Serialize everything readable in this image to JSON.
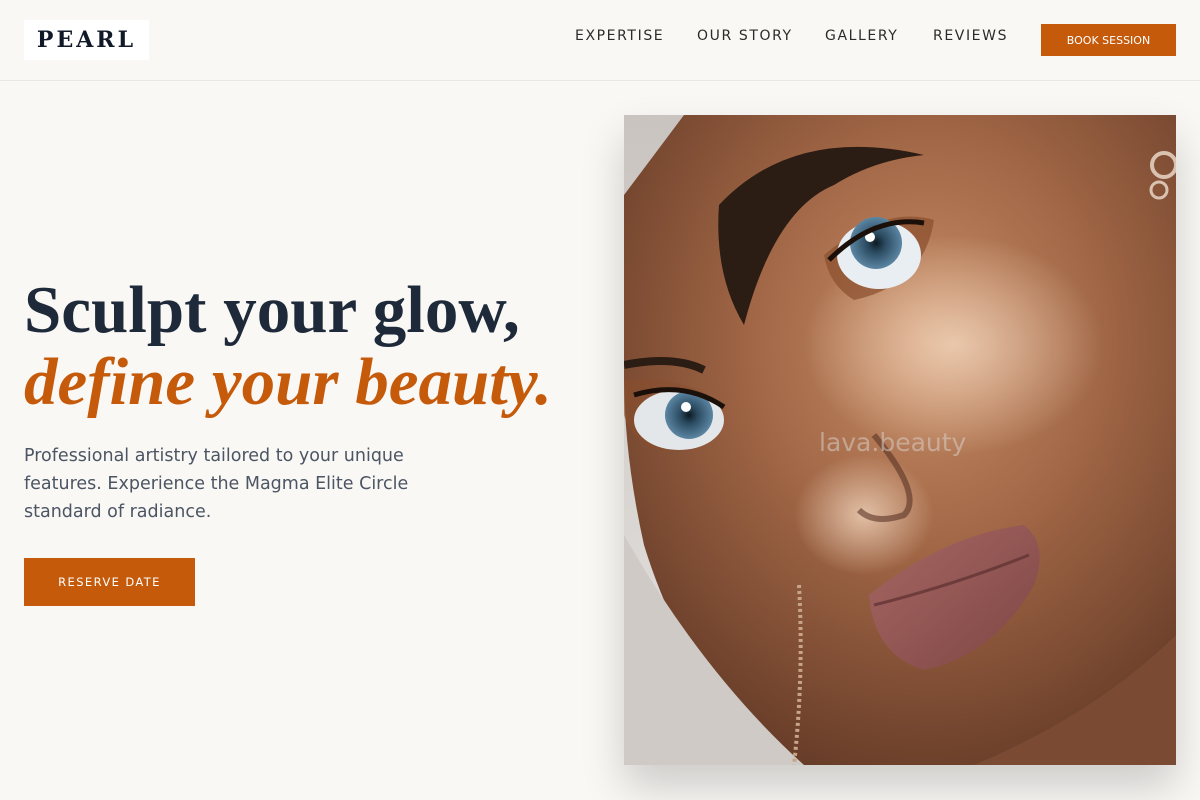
{
  "brand": {
    "logo_text": "PEARL"
  },
  "nav": {
    "items": [
      {
        "label": "EXPERTISE"
      },
      {
        "label": "OUR STORY"
      },
      {
        "label": "GALLERY"
      },
      {
        "label": "REVIEWS"
      }
    ],
    "cta_label": "BOOK SESSION"
  },
  "hero": {
    "headline_line1": "Sculpt your glow,",
    "headline_line2": "define your beauty.",
    "subcopy": "Professional artistry tailored to your unique features. Experience the Magma Elite Circle standard of radiance.",
    "cta_label": "RESERVE DATE",
    "image": {
      "subject": "close-up portrait photo",
      "watermark": "lava.beauty"
    }
  },
  "colors": {
    "accent": "#c65a0b",
    "background": "#faf8f5",
    "heading": "#1e2a3a",
    "body_text": "#4b5563"
  }
}
